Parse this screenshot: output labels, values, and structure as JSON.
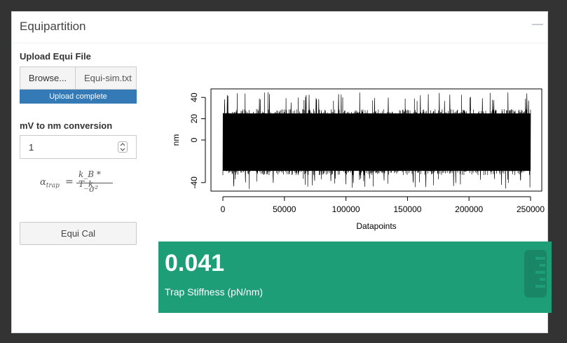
{
  "box": {
    "title": "Equipartition",
    "collapse_icon": "minus-icon"
  },
  "upload": {
    "label": "Upload Equi File",
    "browse_label": "Browse...",
    "file_name": "Equi-sim.txt",
    "progress_text": "Upload complete",
    "progress": 1.0
  },
  "conversion": {
    "label": "mV to nm conversion",
    "value": "1"
  },
  "formula": {
    "lhs": "α",
    "lhs_sub": "trap",
    "eq": "=",
    "numerator": "k_B * T_k",
    "denominator": "σ²"
  },
  "button": {
    "label": "Equi Cal"
  },
  "value_box": {
    "value": "0.041",
    "subtitle": "Trap Stiffness (pN/nm)",
    "icon": "ruler-icon",
    "color": "#1e9e77"
  },
  "chart_data": {
    "type": "line",
    "title": "",
    "xlabel": "Datapoints",
    "ylabel": "nm",
    "xlim": [
      0,
      250000
    ],
    "ylim": [
      -48,
      48
    ],
    "x_ticks": [
      "0",
      "50000",
      "100000",
      "150000",
      "200000",
      "250000"
    ],
    "y_ticks": [
      "-40",
      "0",
      "20",
      "40"
    ],
    "y_tick_values": [
      -40,
      0,
      20,
      40
    ],
    "x_tick_values": [
      0,
      50000,
      100000,
      150000,
      200000,
      250000
    ],
    "series": [
      {
        "x_range": [
          0,
          250000
        ],
        "typical_range": [
          -33,
          29
        ],
        "extremes": [
          -46,
          45
        ],
        "color": "#000000"
      }
    ]
  }
}
